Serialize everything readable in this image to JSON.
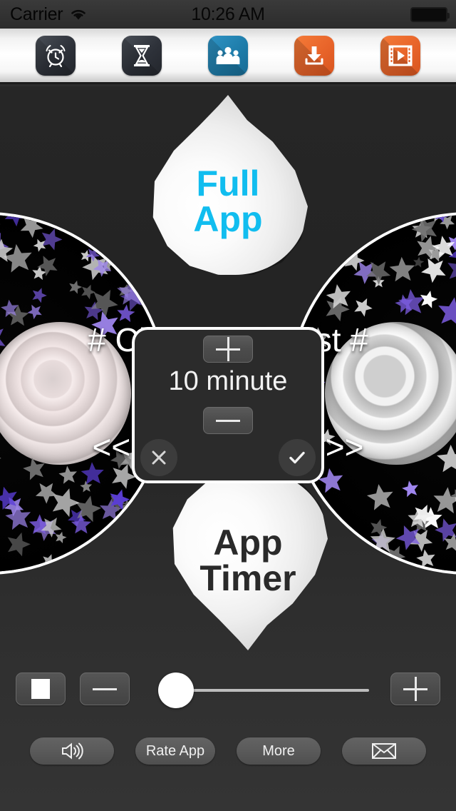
{
  "status_bar": {
    "carrier": "Carrier",
    "wifi_icon": "wifi-icon",
    "time": "10:26 AM",
    "battery_icon": "battery-icon"
  },
  "toolbar": {
    "items": [
      {
        "name": "alarm-clock",
        "icon": "alarm-clock-icon",
        "color": "#2e323a"
      },
      {
        "name": "hourglass",
        "icon": "hourglass-icon",
        "color": "#2e323a"
      },
      {
        "name": "people",
        "icon": "people-icon",
        "color": "#1d7ba8"
      },
      {
        "name": "download",
        "icon": "download-icon",
        "color": "#e8642a"
      },
      {
        "name": "video",
        "icon": "video-icon",
        "color": "#e8642a"
      }
    ]
  },
  "stage": {
    "full_app_label_line1": "Full",
    "full_app_label_line2": "App",
    "full_app_color": "#11bdef",
    "app_timer_label_line1": "App",
    "app_timer_label_line2": "Timer",
    "app_timer_color": "#2a2a2a",
    "headline_playlist": "# Choose Playlist #",
    "headline_switch": "<< Switch Light >>"
  },
  "timer_dialog": {
    "plus_label": "+",
    "value": "10 minute",
    "minus_label": "−",
    "cancel_icon": "close-icon",
    "confirm_icon": "check-icon"
  },
  "controls": {
    "stop_icon": "stop-icon",
    "volume_down_icon": "minus-icon",
    "volume_up_icon": "plus-icon",
    "slider_value": 0
  },
  "bottom_bar": {
    "sound_icon": "speaker-icon",
    "rate_app_label": "Rate App",
    "more_label": "More",
    "mail_icon": "envelope-icon"
  }
}
